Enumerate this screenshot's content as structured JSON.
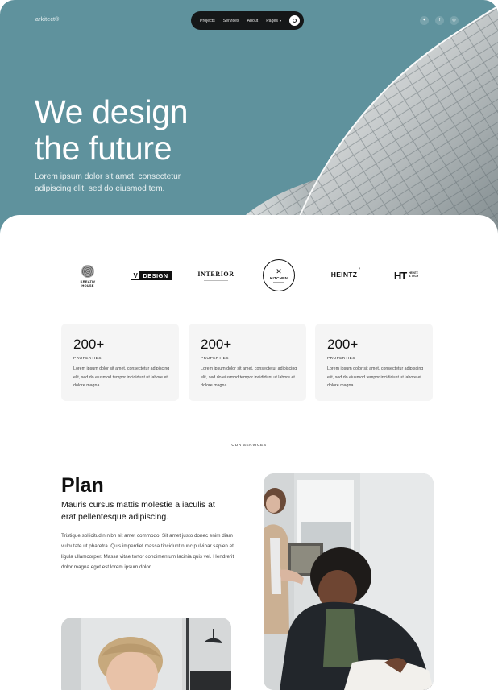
{
  "header": {
    "brand": "arkitect®",
    "nav": [
      {
        "label": "Projects"
      },
      {
        "label": "Services"
      },
      {
        "label": "About"
      },
      {
        "label": "Pages",
        "caret": "▾"
      }
    ],
    "nav_icon": "circle-icon",
    "social_icons": [
      "twitter-icon",
      "facebook-icon",
      "instagram-icon"
    ]
  },
  "hero": {
    "title_line1": "We design",
    "title_line2": "the future",
    "subtitle": "Lorem ipsum dolor sit amet, consectetur adipiscing elit, sed do eiusmod tem."
  },
  "logos": {
    "kreativ": {
      "line1": "KREATIV",
      "line2": "HOUSE"
    },
    "vdesign": {
      "mark": "V",
      "text": "DESIGN"
    },
    "interior": {
      "text": "INTERIOR"
    },
    "kitchen": {
      "glyph": "✕",
      "text": "KITCHEN"
    },
    "heintz": {
      "text": "HEINTZ"
    },
    "ht": {
      "mark": "HT",
      "line1": "HEINTZ",
      "line2": "& TECH"
    }
  },
  "stats": [
    {
      "value": "200+",
      "label": "PROPERTIES",
      "desc": "Lorem ipsum dolor sit amet, consectetur adipiscing elit, sed do eiusmod tempor incididunt ut labore et dolore magna."
    },
    {
      "value": "200+",
      "label": "PROPERTIES",
      "desc": "Lorem ipsum dolor sit amet, consectetur adipiscing elit, sed do eiusmod tempor incididunt ut labore et dolore magna."
    },
    {
      "value": "200+",
      "label": "PROPERTIES",
      "desc": "Lorem ipsum dolor sit amet, consectetur adipiscing elit, sed do eiusmod tempor incididunt ut labore et dolore magna."
    }
  ],
  "services": {
    "section_label": "OUR SERVICES",
    "title": "Plan",
    "subtitle": "Mauris cursus mattis molestie a iaculis at erat pellentesque adipiscing.",
    "body": "Tristique sollicitudin nibh sit amet commodo. Sit amet justo donec enim diam vulputate ut pharetra. Quis imperdiet massa tincidunt nunc pulvinar sapien et ligula ullamcorper. Massa vitae tortor condimentum lacinia quis vel. Hendrerit dolor magna eget est lorem ipsum dolor."
  },
  "colors": {
    "hero_bg": "#5f929d",
    "nav_bg": "#151718",
    "card_bg": "#f5f5f5"
  }
}
